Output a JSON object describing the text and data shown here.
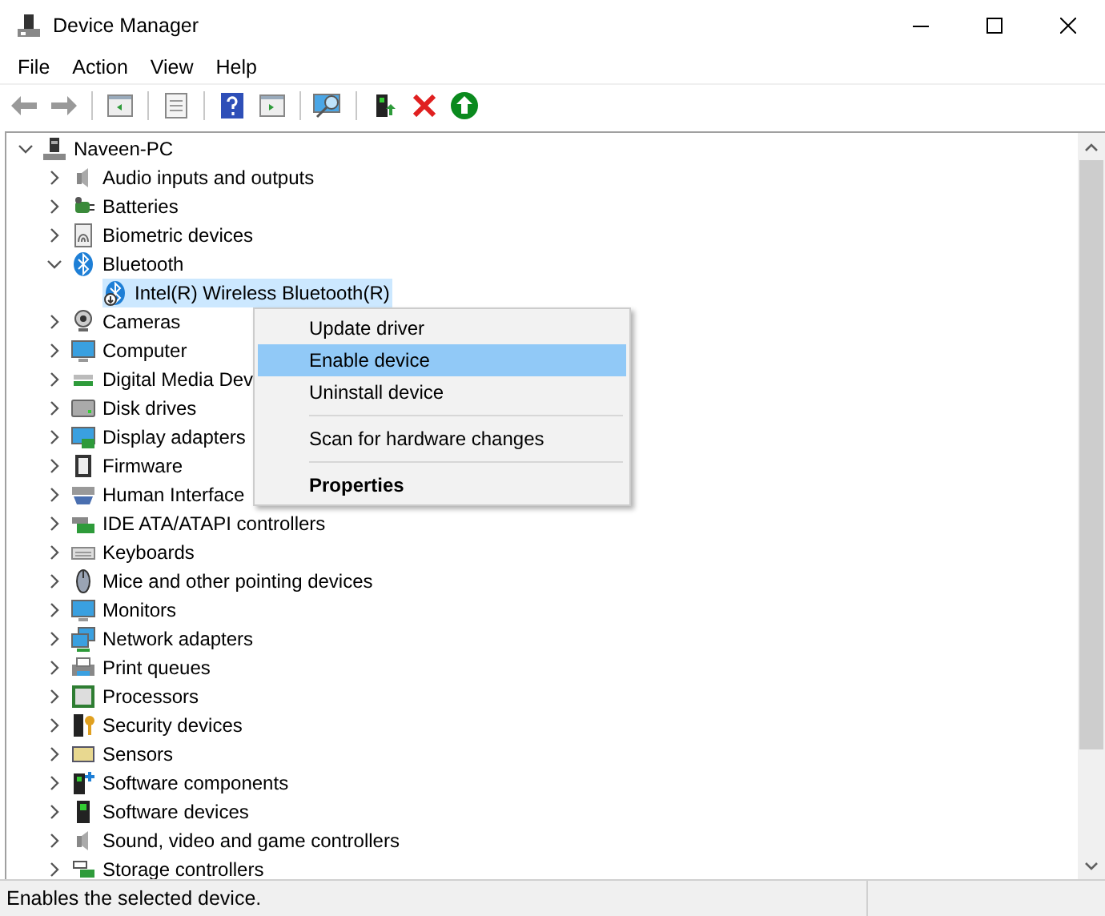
{
  "window": {
    "title": "Device Manager"
  },
  "menu_bar": [
    "File",
    "Action",
    "View",
    "Help"
  ],
  "tree": {
    "label": "Naveen-PC",
    "expanded": true,
    "selected": false,
    "children": [
      {
        "label": "Audio inputs and outputs",
        "expanded": false,
        "selected": false
      },
      {
        "label": "Batteries",
        "expanded": false,
        "selected": false
      },
      {
        "label": "Biometric devices",
        "expanded": false,
        "selected": false
      },
      {
        "label": "Bluetooth",
        "expanded": true,
        "selected": false,
        "children": [
          {
            "label": "Intel(R) Wireless Bluetooth(R)",
            "selected": true
          }
        ]
      },
      {
        "label": "Cameras",
        "expanded": false,
        "selected": false
      },
      {
        "label": "Computer",
        "expanded": false,
        "selected": false
      },
      {
        "label": "Digital Media Dev",
        "expanded": false,
        "selected": false
      },
      {
        "label": "Disk drives",
        "expanded": false,
        "selected": false
      },
      {
        "label": "Display adapters",
        "expanded": false,
        "selected": false
      },
      {
        "label": "Firmware",
        "expanded": false,
        "selected": false
      },
      {
        "label": "Human Interface",
        "expanded": false,
        "selected": false
      },
      {
        "label": "IDE ATA/ATAPI controllers",
        "expanded": false,
        "selected": false
      },
      {
        "label": "Keyboards",
        "expanded": false,
        "selected": false
      },
      {
        "label": "Mice and other pointing devices",
        "expanded": false,
        "selected": false
      },
      {
        "label": "Monitors",
        "expanded": false,
        "selected": false
      },
      {
        "label": "Network adapters",
        "expanded": false,
        "selected": false
      },
      {
        "label": "Print queues",
        "expanded": false,
        "selected": false
      },
      {
        "label": "Processors",
        "expanded": false,
        "selected": false
      },
      {
        "label": "Security devices",
        "expanded": false,
        "selected": false
      },
      {
        "label": "Sensors",
        "expanded": false,
        "selected": false
      },
      {
        "label": "Software components",
        "expanded": false,
        "selected": false
      },
      {
        "label": "Software devices",
        "expanded": false,
        "selected": false
      },
      {
        "label": "Sound, video and game controllers",
        "expanded": false,
        "selected": false
      },
      {
        "label": "Storage controllers",
        "expanded": false,
        "selected": false
      }
    ]
  },
  "context_menu": [
    {
      "kind": "item",
      "label": "Update driver",
      "selected": false,
      "default": false
    },
    {
      "kind": "item",
      "label": "Enable device",
      "selected": true,
      "default": false
    },
    {
      "kind": "item",
      "label": "Uninstall device",
      "selected": false,
      "default": false
    },
    {
      "kind": "separator"
    },
    {
      "kind": "item",
      "label": "Scan for hardware changes",
      "selected": false,
      "default": false
    },
    {
      "kind": "separator"
    },
    {
      "kind": "item",
      "label": "Properties",
      "selected": false,
      "default": true
    }
  ],
  "status_bar": "Enables the selected device."
}
